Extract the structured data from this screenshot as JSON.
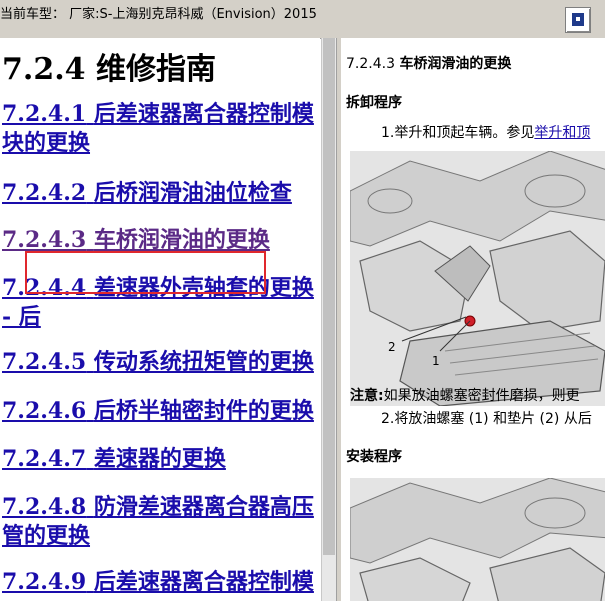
{
  "window": {
    "title": "当前车型： 厂家:S-上海别克昂科威（Envision）2015",
    "button_icon": "window-toggle-icon"
  },
  "left": {
    "heading": "7.2.4 维修指南",
    "toc": [
      {
        "num": "7.2.4.1",
        "text": "后差速器离合器控制模块的更换"
      },
      {
        "num": "7.2.4.2",
        "text": "后桥润滑油油位检查"
      },
      {
        "num": "7.2.4.3",
        "text": "车桥润滑油的更换"
      },
      {
        "num": "7.2.4.4",
        "text": "差速器外壳轴套的更换 - 后"
      },
      {
        "num": "7.2.4.5",
        "text": "传动系统扭矩管的更换"
      },
      {
        "num": "7.2.4.6",
        "text": "后桥半轴密封件的更换"
      },
      {
        "num": "7.2.4.7",
        "text": "差速器的更换"
      },
      {
        "num": "7.2.4.8",
        "text": "防滑差速器离合器高压管的更换"
      },
      {
        "num": "7.2.4.9",
        "text": "后差速器离合器控制模"
      }
    ]
  },
  "right": {
    "section_num": "7.2.4.3",
    "section_title": "车桥润滑油的更换",
    "removal_heading": "拆卸程序",
    "step1_prefix": "1.举升和顶起车辆。参见",
    "step1_link": "举升和顶",
    "figure1_callouts": [
      "2",
      "1"
    ],
    "note_label": "注意:",
    "note_text": "如果放油螺塞密封件磨损，则更",
    "step2": "2.将放油螺塞 (1) 和垫片 (2) 从后",
    "install_heading": "安装程序"
  }
}
